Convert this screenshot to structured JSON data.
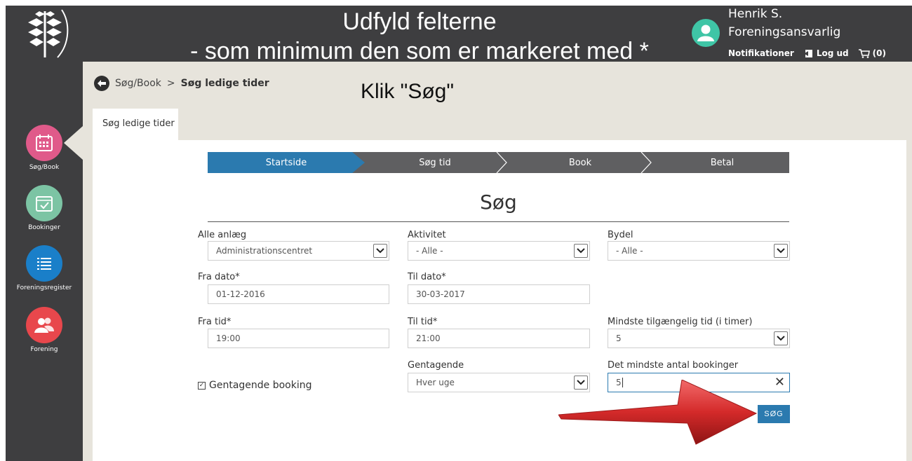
{
  "annotations": {
    "line1": "Udfyld felterne",
    "line2": "- som minimum den som er markeret med *",
    "klik": "Klik \"Søg\""
  },
  "header": {
    "user_name": "Henrik S.",
    "user_role": "Foreningsansvarlig",
    "notifications": "Notifikationer",
    "logout": "Log ud",
    "cart": "(0)"
  },
  "sidebar": {
    "items": [
      {
        "label": "Søg/Book",
        "icon": "calendar-icon",
        "color": "#e05a8a"
      },
      {
        "label": "Bookinger",
        "icon": "calendar-check-icon",
        "color": "#7cc4a4"
      },
      {
        "label": "Foreningsregister",
        "icon": "list-icon",
        "color": "#1a7fc9"
      },
      {
        "label": "Forening",
        "icon": "users-icon",
        "color": "#e8474c"
      }
    ]
  },
  "breadcrumb": {
    "parent": "Søg/Book",
    "separator": ">",
    "current": "Søg ledige tider"
  },
  "tab": {
    "label": "Søg ledige tider"
  },
  "wizard": {
    "steps": [
      "Startside",
      "Søg tid",
      "Book",
      "Betal"
    ],
    "active": 0
  },
  "form": {
    "title": "Søg",
    "alle_anlaeg": {
      "label": "Alle anlæg",
      "value": "Administrationscentret"
    },
    "aktivitet": {
      "label": "Aktivitet",
      "value": "- Alle -"
    },
    "bydel": {
      "label": "Bydel",
      "value": "- Alle -"
    },
    "fra_dato": {
      "label": "Fra dato*",
      "value": "01-12-2016"
    },
    "til_dato": {
      "label": "Til dato*",
      "value": "30-03-2017"
    },
    "fra_tid": {
      "label": "Fra tid*",
      "value": "19:00"
    },
    "til_tid": {
      "label": "Til tid*",
      "value": "21:00"
    },
    "min_tid": {
      "label": "Mindste tilgængelig tid (i timer)",
      "value": "5"
    },
    "gentagende_booking": {
      "label": "Gentagende booking",
      "checked": true
    },
    "gentagende": {
      "label": "Gentagende",
      "value": "Hver uge"
    },
    "min_bookinger": {
      "label": "Det mindste antal bookinger",
      "value": "5"
    },
    "search_button": "SØG"
  },
  "colors": {
    "dark": "#3e3e40",
    "accent_blue": "#2b7aaf",
    "background": "#e7e4dc",
    "arrow_red": "#d42a2a"
  }
}
